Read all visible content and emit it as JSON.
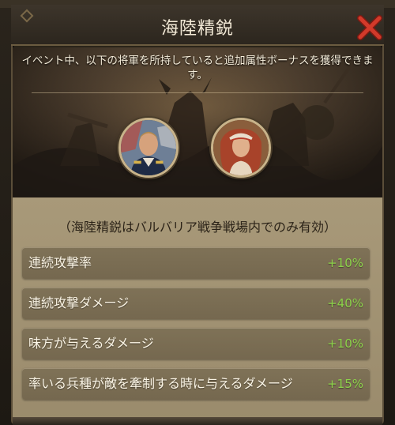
{
  "window": {
    "title": "海陸精鋭",
    "close_icon": "close-x-icon"
  },
  "event": {
    "description": "イベント中、以下の将軍を所持していると追加属性ボーナスを獲得できます。"
  },
  "generals": [
    {
      "icon": "general-portrait-male-officer"
    },
    {
      "icon": "general-portrait-female-pirate"
    }
  ],
  "note": "（海陸精鋭はバルバリア戦争戦場内でのみ有効）",
  "bonuses": [
    {
      "label": "連続攻撃率",
      "value": "+10%"
    },
    {
      "label": "連続攻撃ダメージ",
      "value": "+40%"
    },
    {
      "label": "味方が与えるダメージ",
      "value": "+10%"
    },
    {
      "label": "率いる兵種が敵を牽制する時に与えるダメージ",
      "value": "+15%"
    }
  ],
  "colors": {
    "bonus_value": "#8cd24a",
    "close_icon": "#d23a2a",
    "portrait_ring": "#c8b38a"
  }
}
